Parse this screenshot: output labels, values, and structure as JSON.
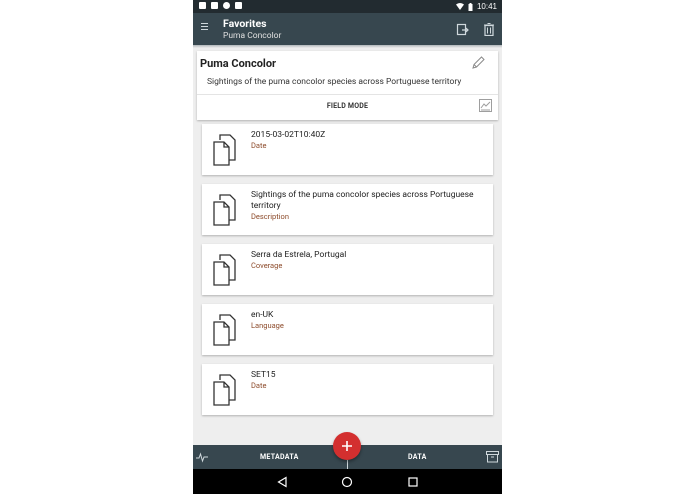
{
  "status_bar": {
    "time": "10:41"
  },
  "app_bar": {
    "title": "Favorites",
    "subtitle": "Puma Concolor",
    "icons": [
      "menu-icon",
      "export-icon",
      "delete-icon"
    ]
  },
  "header": {
    "name": "Puma Concolor",
    "description": "Sightings of the puma concolor species across Portuguese territory",
    "field_mode_label": "FIELD MODE"
  },
  "items": [
    {
      "value": "2015-03-02T10:40Z",
      "label": "Date"
    },
    {
      "value": "Sightings of the puma concolor species across Portuguese territory",
      "label": "Description"
    },
    {
      "value": "Serra da Estrela, Portugal",
      "label": "Coverage"
    },
    {
      "value": "en-UK",
      "label": "Language"
    },
    {
      "value": "SET15",
      "label": "Date"
    }
  ],
  "bottom_bar": {
    "metadata_label": "METADATA",
    "data_label": "DATA"
  },
  "colors": {
    "app_bar": "#37474f",
    "status_bar": "#222b30",
    "fab": "#d32f2f",
    "field_label": "#8d4b2b"
  }
}
